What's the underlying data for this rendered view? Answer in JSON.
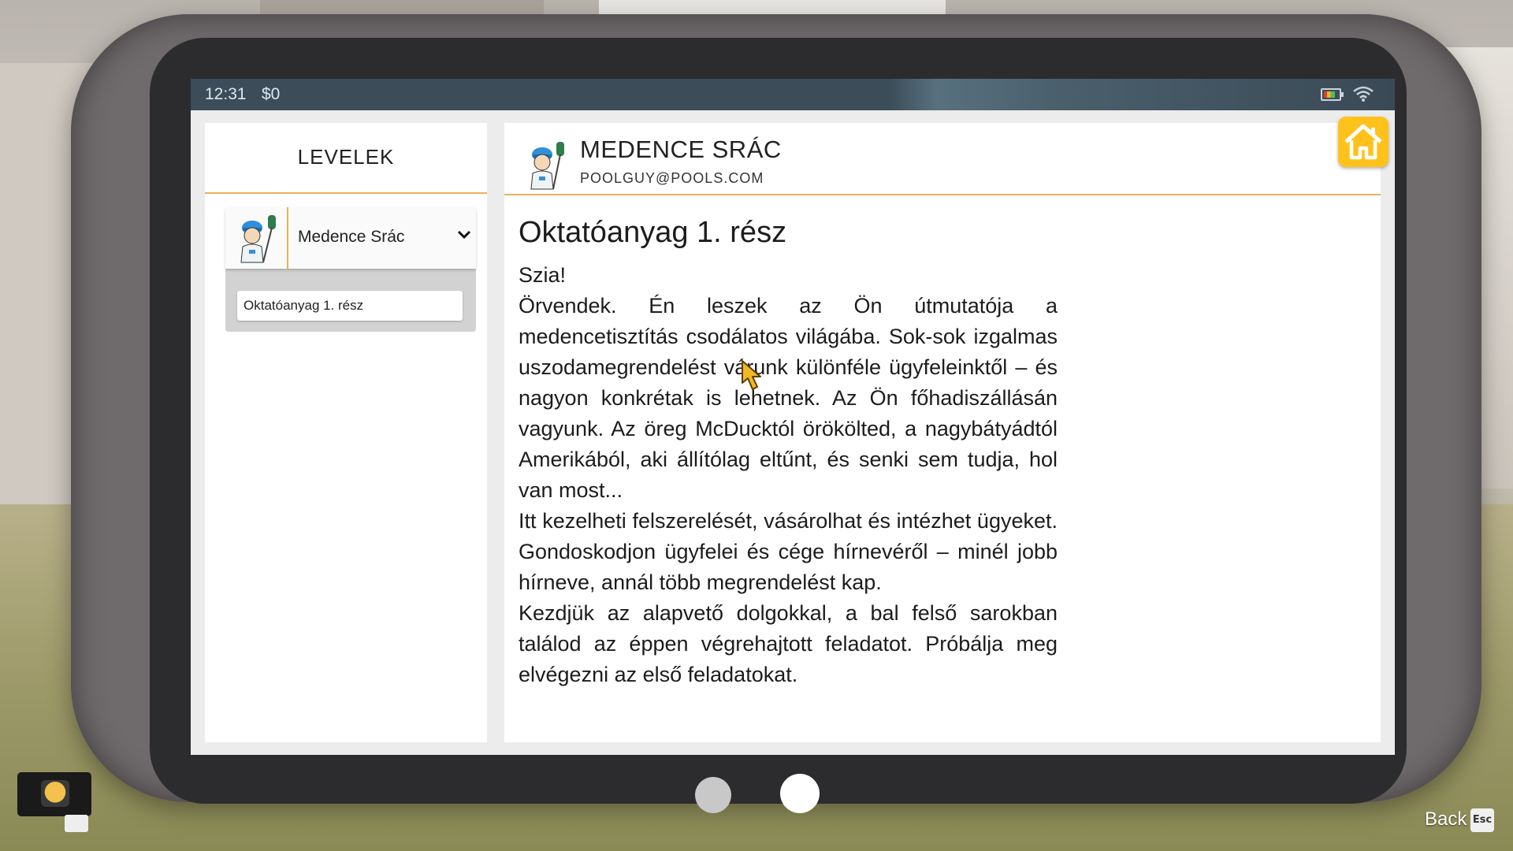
{
  "status_bar": {
    "time": "12:31",
    "money": "$0"
  },
  "mail_list": {
    "title": "LEVELEK",
    "senders": [
      {
        "name": "Medence Srác",
        "messages": [
          "Oktatóanyag 1. rész"
        ]
      }
    ]
  },
  "message": {
    "from_name": "MEDENCE SRÁC",
    "from_email": "POOLGUY@POOLS.COM",
    "subject": "Oktatóanyag 1. rész",
    "paragraphs": [
      "Szia!",
      "Örvendek. Én leszek az Ön útmutatója a medencetisztítás csodálatos világába. Sok-sok izgalmas uszodamegrendelést várunk különféle ügyfeleinktől – és nagyon konkrétak is lehetnek. Az Ön főhadiszállásán vagyunk. Az öreg McDucktól örökölted, a nagybátyádtól Amerikából, aki állítólag eltűnt, és senki sem tudja, hol van most...",
      "Itt kezelheti felszerelését, vásárolhat és intézhet ügyeket. Gondoskodjon ügyfelei és cége hírnevéről – minél jobb hírneve, annál több megrendelést kap.",
      "Kezdjük az alapvető dolgokkal, a bal felső sarokban találod az éppen végrehajtott feladatot. Próbálja meg elvégezni az első feladatokat."
    ]
  },
  "footer": {
    "back_label": "Back",
    "esc_key": "Esc"
  },
  "colors": {
    "accent": "#e7b25a",
    "home_button": "#ffc21a",
    "status_bar": "#3c4c59"
  },
  "icons": [
    "battery-icon",
    "wifi-icon",
    "home-icon",
    "avatar",
    "chevron-down-icon",
    "cursor-icon"
  ]
}
